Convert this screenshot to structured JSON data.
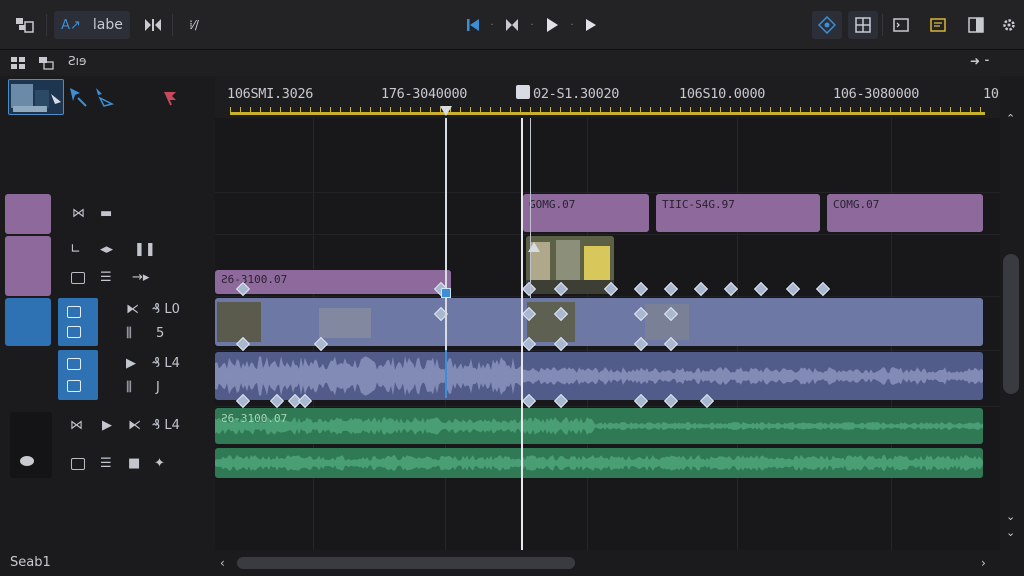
{
  "toolbar": {
    "workspace_label": "labe",
    "right_icons": [
      "target-icon",
      "grid-icon",
      "terminal-icon",
      "message-icon",
      "window-icon",
      "settings-icon"
    ]
  },
  "subbar": {
    "label": "Ƨıɘ"
  },
  "ruler": {
    "ticks": [
      "106SMI.3026",
      "176-3040000",
      "02-S1.30020",
      "106S10.0000",
      "106-3080000",
      "10"
    ]
  },
  "tracks": {
    "v_top_clips": [
      "GOMG.07",
      "TIIC-S4G.97",
      "COMG.07"
    ],
    "v_mid_clip": "Ƨ6-3100.07",
    "a1_label": "L0",
    "a1_num": "5",
    "a2_label": "L4",
    "a2_num": "J",
    "a3_label": "L4",
    "a3_clip": "Ƨ6-3100.07"
  },
  "status": {
    "label": "Seab1"
  },
  "colors": {
    "accent": "#3c8fd6",
    "ruler": "#c9b12b",
    "purple_clip": "#8e6a9c",
    "video_clip": "#6e78a5",
    "audio_clip": "#525c8a",
    "green_clip": "#2f7a55"
  }
}
